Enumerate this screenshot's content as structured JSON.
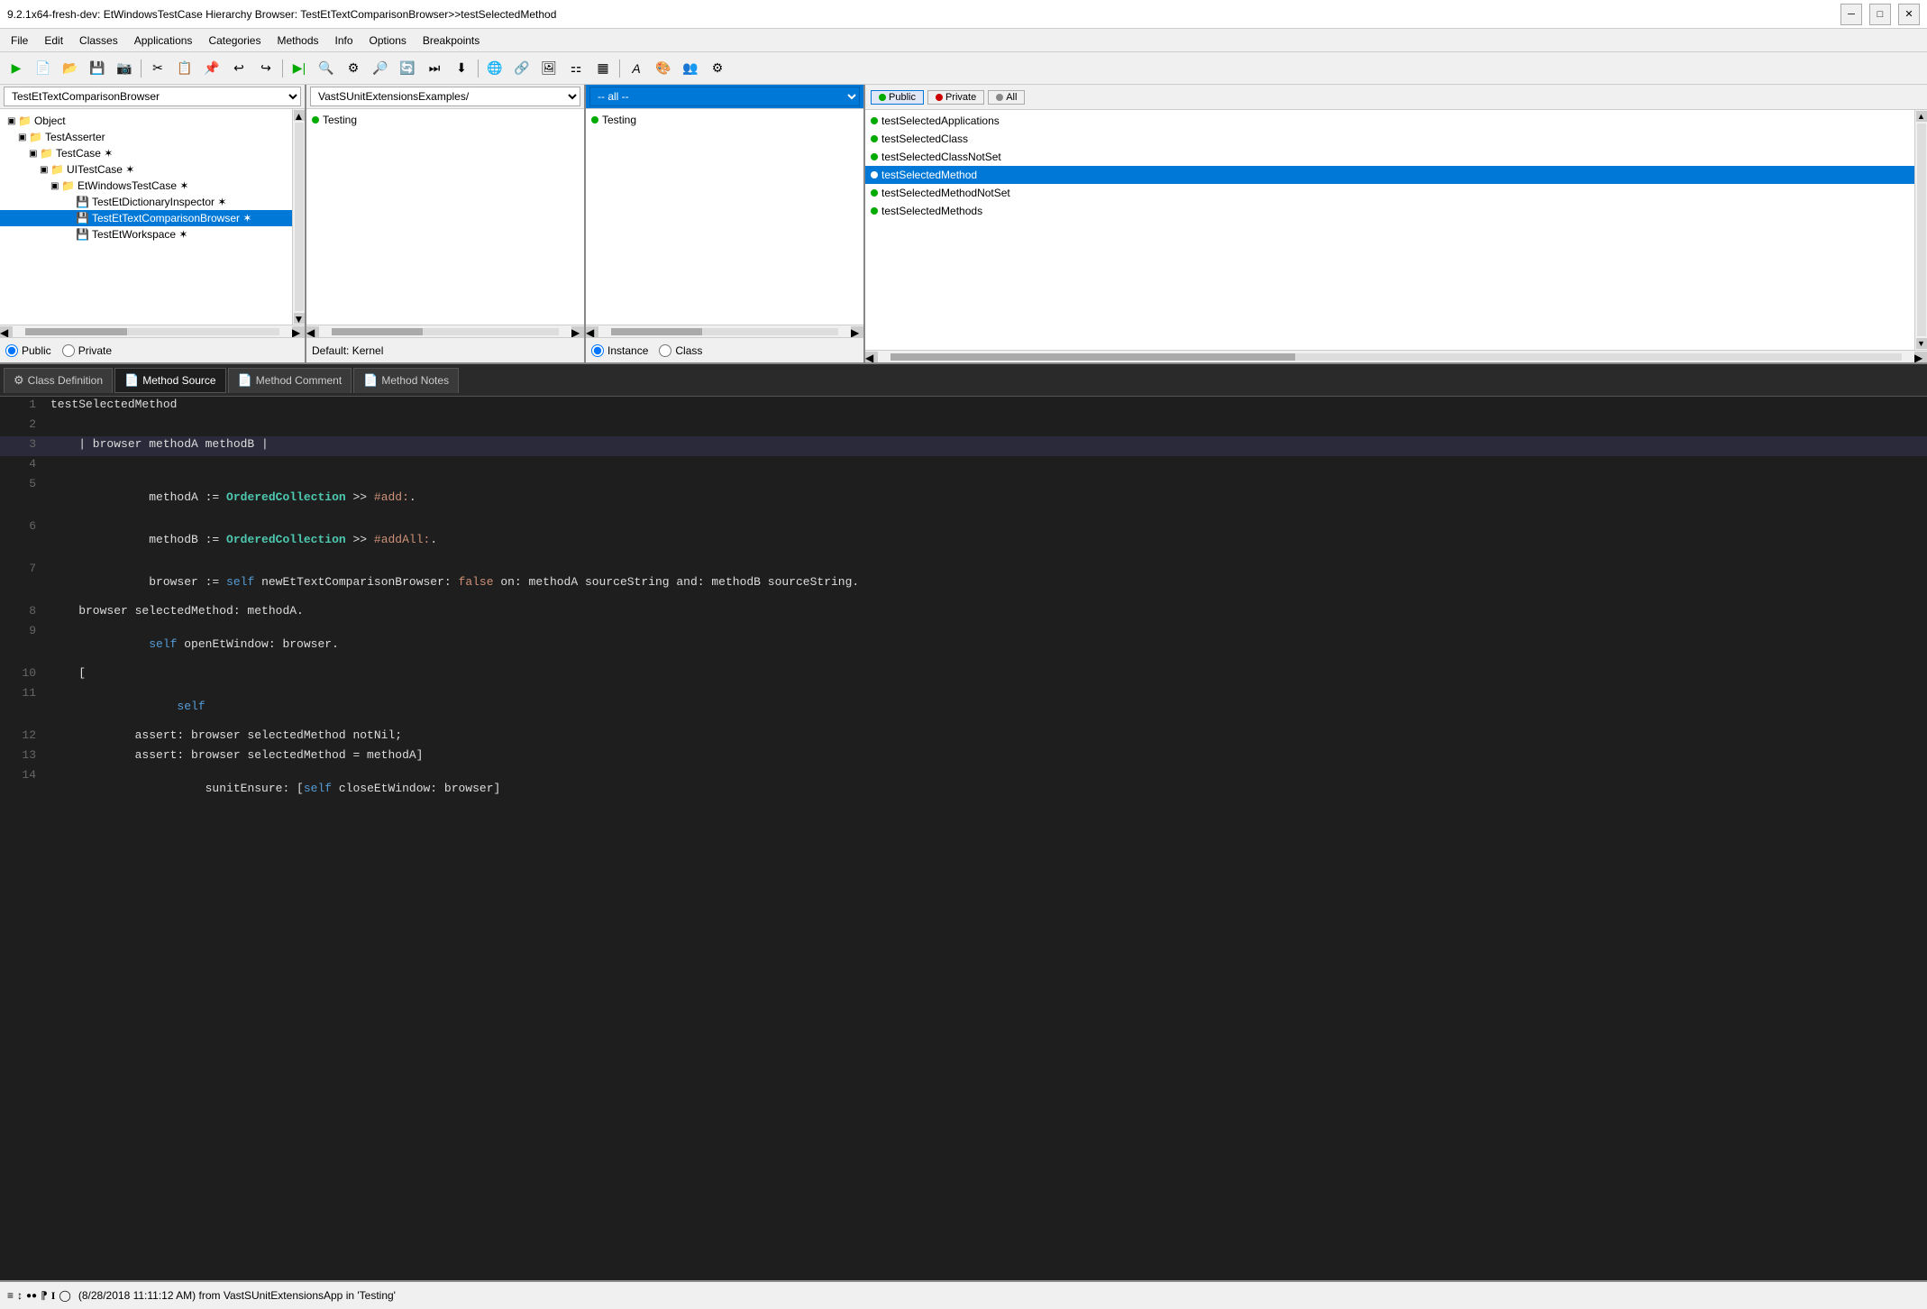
{
  "titleBar": {
    "text": "9.2.1x64-fresh-dev: EtWindowsTestCase Hierarchy Browser: TestEtTextComparisonBrowser>>testSelectedMethod",
    "minimizeBtn": "─",
    "maximizeBtn": "□",
    "closeBtn": "✕"
  },
  "menuBar": {
    "items": [
      "File",
      "Edit",
      "Classes",
      "Applications",
      "Categories",
      "Methods",
      "Info",
      "Options",
      "Breakpoints"
    ]
  },
  "panels": {
    "classHierarchy": {
      "dropdown": "TestEtTextComparisonBrowser",
      "items": [
        {
          "label": "Object",
          "level": 0,
          "expanded": true,
          "icon": "📁"
        },
        {
          "label": "TestAsserter",
          "level": 1,
          "expanded": true,
          "icon": "📁"
        },
        {
          "label": "TestCase ✶",
          "level": 2,
          "expanded": true,
          "icon": "📁"
        },
        {
          "label": "UITestCase ✶",
          "level": 3,
          "expanded": true,
          "icon": "📁"
        },
        {
          "label": "EtWindowsTestCase ✶",
          "level": 4,
          "expanded": true,
          "icon": "📁"
        },
        {
          "label": "TestEtDictionaryInspector ✶",
          "level": 5,
          "icon": "📄"
        },
        {
          "label": "TestEtTextComparisonBrowser ✶",
          "level": 5,
          "icon": "📄",
          "selected": true
        },
        {
          "label": "TestEtWorkspace ✶",
          "level": 5,
          "icon": "📄"
        }
      ],
      "radioButtons": [
        {
          "label": "Public",
          "checked": true
        },
        {
          "label": "Private",
          "checked": false
        }
      ]
    },
    "categories": {
      "dropdown": "VastSUnitExtensionsExamples/",
      "items": [
        {
          "label": "Testing"
        }
      ],
      "footer": "Default: Kernel"
    },
    "protocols": {
      "dropdown": "-- all --",
      "selected": true,
      "items": [
        {
          "label": "Testing"
        }
      ],
      "radioButtons": [
        {
          "label": "Instance",
          "checked": true
        },
        {
          "label": "Class",
          "checked": false
        }
      ]
    },
    "methods": {
      "filterButtons": [
        {
          "label": "Public",
          "dot": "green",
          "active": true
        },
        {
          "label": "Private",
          "dot": "red",
          "active": false
        },
        {
          "label": "All",
          "dot": "gray",
          "active": false
        }
      ],
      "items": [
        {
          "label": "testSelectedApplications"
        },
        {
          "label": "testSelectedClass"
        },
        {
          "label": "testSelectedClassNotSet"
        },
        {
          "label": "testSelectedMethod",
          "selected": true
        },
        {
          "label": "testSelectedMethodNotSet"
        },
        {
          "label": "testSelectedMethods"
        }
      ]
    }
  },
  "tabs": [
    {
      "label": "Class Definition",
      "icon": "⚙",
      "active": false
    },
    {
      "label": "Method Source",
      "icon": "📄",
      "active": true
    },
    {
      "label": "Method Comment",
      "icon": "📄",
      "active": false
    },
    {
      "label": "Method Notes",
      "icon": "📄",
      "active": false
    }
  ],
  "codeEditor": {
    "lines": [
      {
        "num": "1",
        "content": "testSelectedMethod"
      },
      {
        "num": "2",
        "content": ""
      },
      {
        "num": "3",
        "content": "    | browser methodA methodB |"
      },
      {
        "num": "4",
        "content": ""
      },
      {
        "num": "5",
        "content": "    methodA := OrderedCollection >> #add:."
      },
      {
        "num": "6",
        "content": "    methodB := OrderedCollection >> #addAll:."
      },
      {
        "num": "7",
        "content": "    browser := self newEtTextComparisonBrowser: false on: methodA sourceString and: methodB sourceString."
      },
      {
        "num": "8",
        "content": "    browser selectedMethod: methodA."
      },
      {
        "num": "9",
        "content": "    self openEtWindow: browser."
      },
      {
        "num": "10",
        "content": "    ["
      },
      {
        "num": "11",
        "content": "        self"
      },
      {
        "num": "12",
        "content": "            assert: browser selectedMethod notNil;"
      },
      {
        "num": "13",
        "content": "            assert: browser selectedMethod = methodA]"
      },
      {
        "num": "14",
        "content": "            sunitEnsure: [self closeEtWindow: browser]"
      }
    ]
  },
  "statusBar": {
    "text": "(8/28/2018 11:11:12 AM) from VastSUnitExtensionsApp in 'Testing'"
  }
}
